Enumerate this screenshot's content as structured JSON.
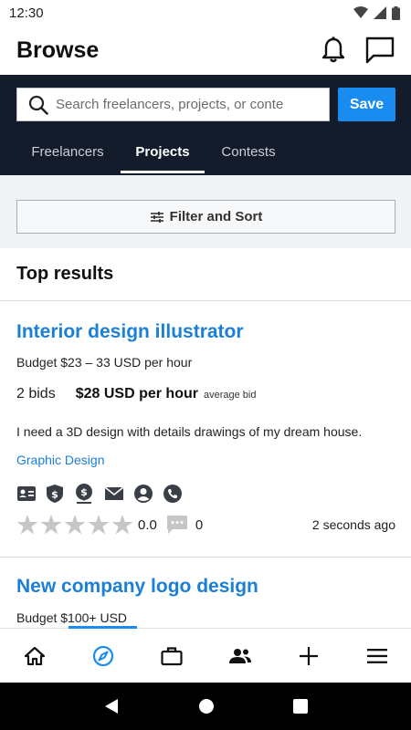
{
  "status_bar": {
    "time": "12:30"
  },
  "header": {
    "title": "Browse"
  },
  "search": {
    "placeholder": "Search freelancers, projects, or conte",
    "save_label": "Save"
  },
  "tabs": [
    {
      "label": "Freelancers",
      "active": false
    },
    {
      "label": "Projects",
      "active": true
    },
    {
      "label": "Contests",
      "active": false
    }
  ],
  "filter": {
    "label": "Filter and Sort"
  },
  "results": {
    "title": "Top results"
  },
  "projects": [
    {
      "title": "Interior design illustrator",
      "budget": "Budget $23 – 33 USD per hour",
      "bids": "2 bids",
      "avg_price": "$28 USD per hour",
      "avg_label": "average bid",
      "description": "I need a 3D design with details drawings of my dream house.",
      "skill": "Graphic Design",
      "verification_icons": [
        "id-card-icon",
        "shield-dollar-icon",
        "payment-icon",
        "email-icon",
        "profile-icon",
        "phone-icon"
      ],
      "rating": "0.0",
      "stars_filled": 0,
      "comments": "0",
      "posted": "2 seconds ago"
    },
    {
      "title": "New company logo design",
      "budget": "Budget $100+ USD"
    }
  ],
  "bottom_nav": [
    {
      "icon": "home-icon",
      "active": false
    },
    {
      "icon": "compass-icon",
      "active": true
    },
    {
      "icon": "briefcase-icon",
      "active": false
    },
    {
      "icon": "people-icon",
      "active": false
    },
    {
      "icon": "plus-icon",
      "active": false
    },
    {
      "icon": "menu-icon",
      "active": false
    }
  ],
  "colors": {
    "accent": "#1a8cf0",
    "link": "#1b7fd6",
    "dark_panel": "#141c2b"
  }
}
